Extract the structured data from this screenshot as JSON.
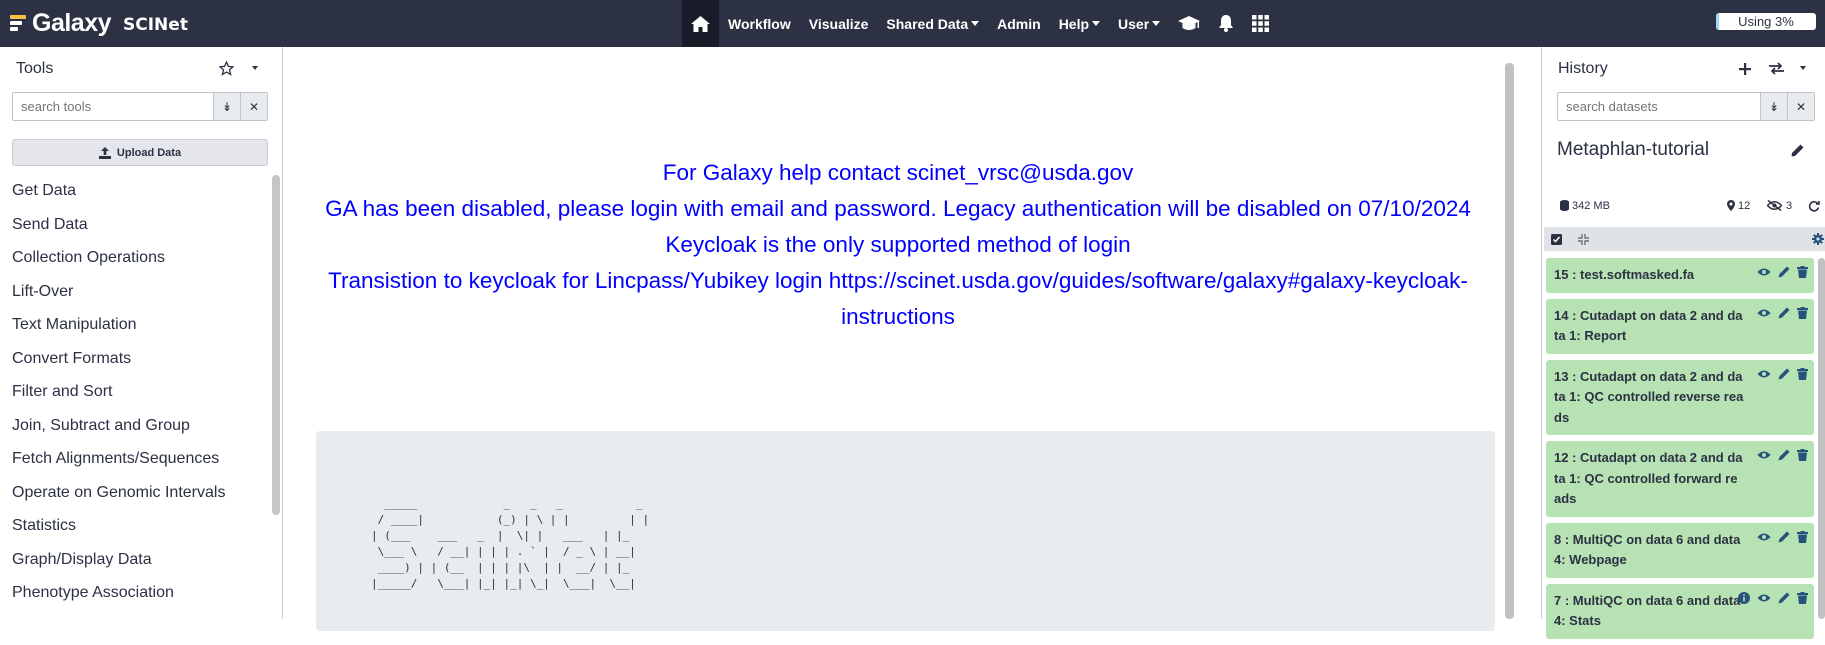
{
  "masthead": {
    "brand": "Galaxy",
    "brand_sub": "SCINet",
    "nav": {
      "workflow": "Workflow",
      "visualize": "Visualize",
      "shared_data": "Shared Data",
      "admin": "Admin",
      "help": "Help",
      "user": "User"
    },
    "quota_text": "Using 3%",
    "quota_percent": 3
  },
  "tools": {
    "title": "Tools",
    "search_placeholder": "search tools",
    "upload_label": "Upload Data",
    "sections": [
      "Get Data",
      "Send Data",
      "Collection Operations",
      "Lift-Over",
      "Text Manipulation",
      "Convert Formats",
      "Filter and Sort",
      "Join, Subtract and Group",
      "Fetch Alignments/Sequences",
      "Operate on Genomic Intervals",
      "Statistics",
      "Graph/Display Data",
      "Phenotype Association"
    ]
  },
  "center": {
    "motd_lines": [
      "For Galaxy help contact scinet_vrsc@usda.gov",
      "GA has been disabled, please login with email and password. Legacy authentication will be disabled on 07/10/2024 Keycloak is the only supported method of login",
      "Transistion to keycloak for Lincpass/Yubikey login https://scinet.usda.gov/guides/software/galaxy#galaxy-keycloak-instructions"
    ],
    "ascii_art": "  _____             _   _   _           _\n / ____|           (_) | \\ | |         | |\n| (___    ___   _  |  \\| |   ___   | |_\n \\___ \\   / __| | | | . ` |  / _ \\ | __|\n ____) | | (__  | | | |\\  | |  __/ | |_\n|_____/   \\___| |_| |_| \\_|  \\___|  \\__|"
  },
  "history": {
    "title": "History",
    "search_placeholder": "search datasets",
    "name": "Metaphlan-tutorial",
    "size": "342 MB",
    "shown_count": "12",
    "hidden_count": "3",
    "datasets": [
      {
        "title": "15 : test.softmasked.fa"
      },
      {
        "title": "14 : Cutadapt on data 2 and data 1: Report"
      },
      {
        "title": "13 : Cutadapt on data 2 and data 1: QC controlled reverse reads"
      },
      {
        "title": "12 : Cutadapt on data 2 and data 1: QC controlled forward reads"
      },
      {
        "title": "8 : MultiQC on data 6 and data 4: Webpage"
      },
      {
        "title": "7 : MultiQC on data 6 and data 4: Stats"
      }
    ]
  },
  "colors": {
    "masthead": "#2c3143",
    "motd_text": "#0000ff",
    "dataset_ok": "#b7e2b3"
  }
}
